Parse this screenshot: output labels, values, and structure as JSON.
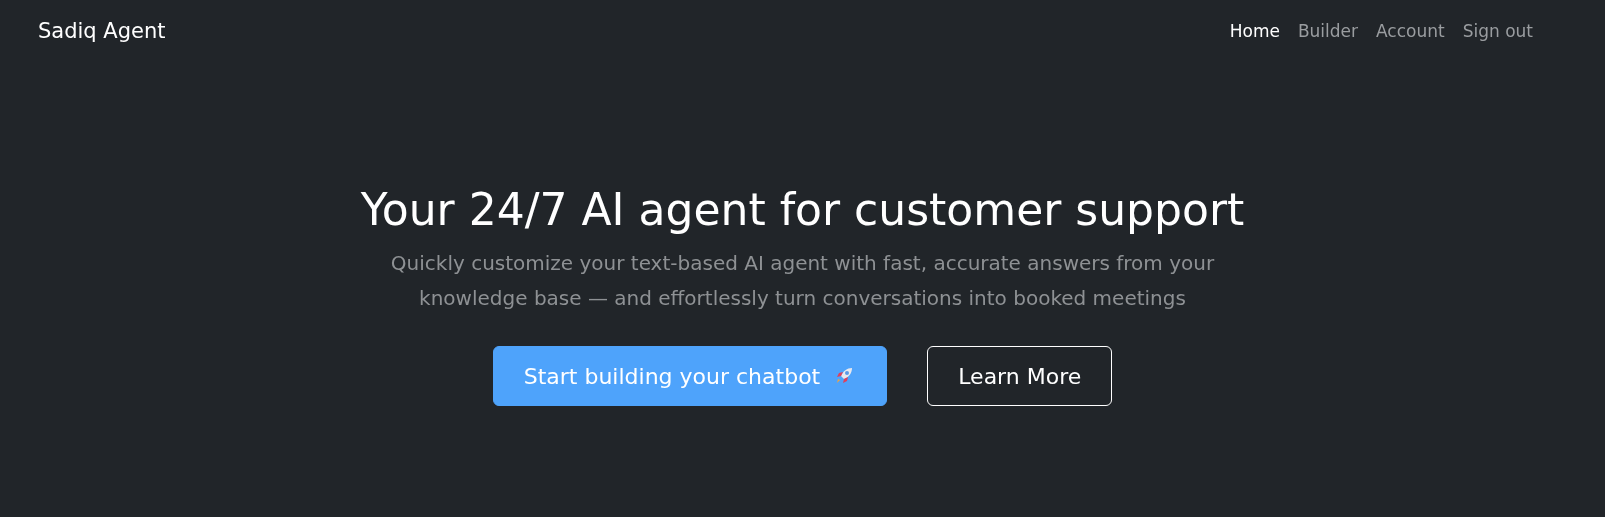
{
  "brand": "Sadiq Agent",
  "nav": [
    {
      "label": "Home",
      "selected": true
    },
    {
      "label": "Builder",
      "selected": false
    },
    {
      "label": "Account",
      "selected": false
    },
    {
      "label": "Sign out",
      "selected": false
    }
  ],
  "hero": {
    "title": "Your 24/7 AI agent for customer support",
    "subtitle": "Quickly customize your text-based AI agent with fast, accurate answers from your knowledge base — and effortlessly turn conversations into booked meetings"
  },
  "buttons": [
    {
      "label": "Start building your chatbot",
      "kind": "primary"
    },
    {
      "label": "Learn More",
      "kind": "outline"
    }
  ]
}
